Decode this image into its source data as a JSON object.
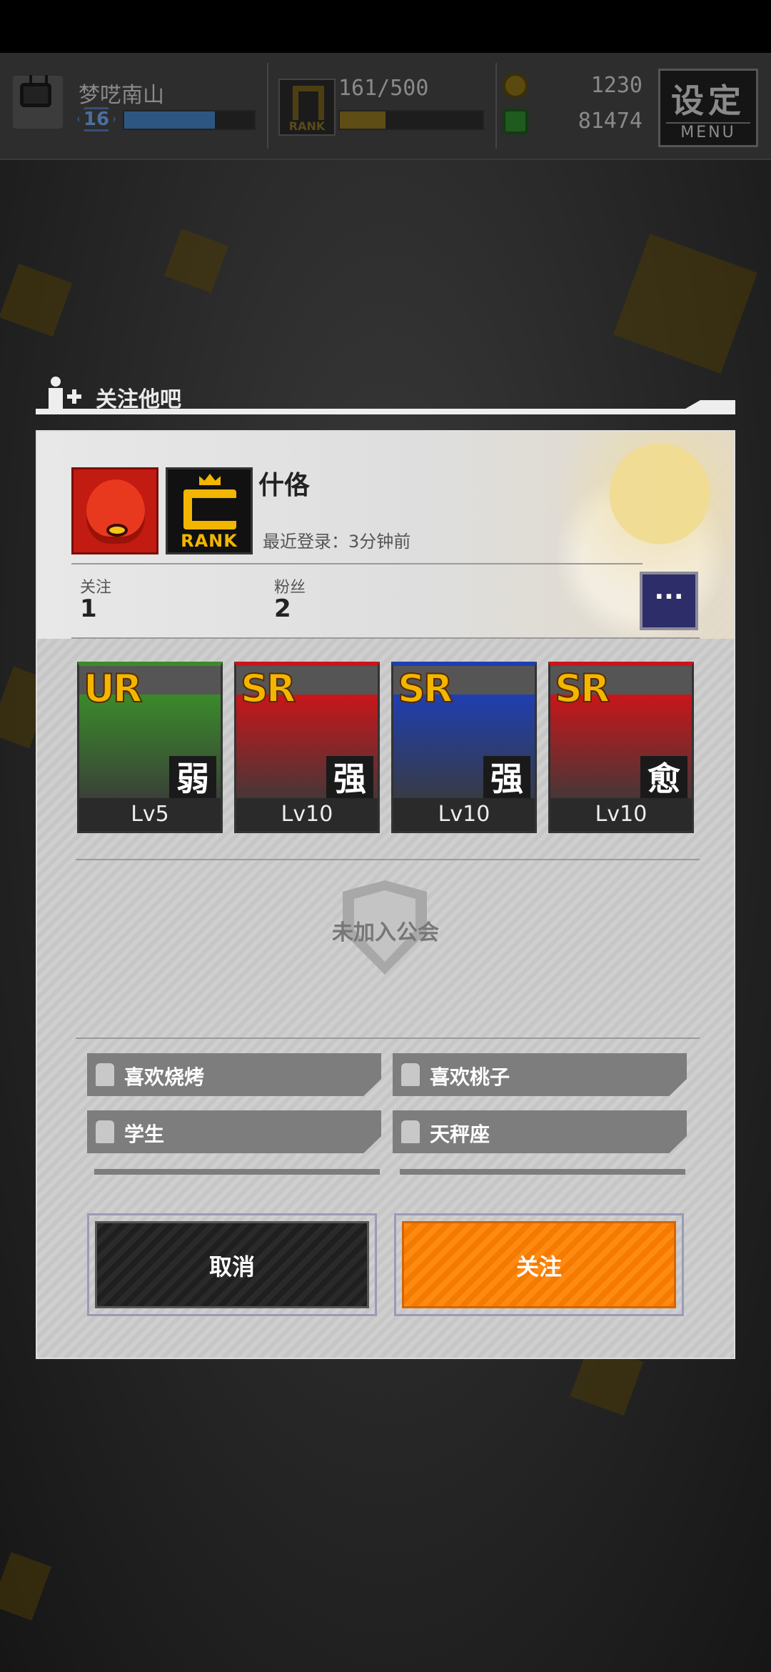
{
  "hud": {
    "player_name": "梦呓南山",
    "player_level": "16",
    "player_level_progress": 0.7,
    "rank_value": "161/500",
    "rank_progress": 0.32,
    "rank_icon_label": "RANK",
    "currency_gold": "1230",
    "currency_gem": "81474",
    "menu_big": "设定",
    "menu_small": "MENU"
  },
  "dialog": {
    "title": "关注他吧",
    "profile": {
      "name": "什佫",
      "rank_label": "RANK",
      "last_login": "最近登录：3分钟前",
      "follow_label": "关注",
      "follow_value": "1",
      "fans_label": "粉丝",
      "fans_value": "2",
      "more_label": "···"
    },
    "cards": [
      {
        "rarity": "UR",
        "attribute": "弱",
        "level": "Lv5",
        "color": "#3a8a2a"
      },
      {
        "rarity": "SR",
        "attribute": "强",
        "level": "Lv10",
        "color": "#c8161a"
      },
      {
        "rarity": "SR",
        "attribute": "强",
        "level": "Lv10",
        "color": "#1f3fb0"
      },
      {
        "rarity": "SR",
        "attribute": "愈",
        "level": "Lv10",
        "color": "#c8161a"
      }
    ],
    "guild_text": "未加入公会",
    "tags": [
      "喜欢烧烤",
      "喜欢桃子",
      "学生",
      "天秤座"
    ],
    "cancel_label": "取消",
    "follow_button_label": "关注"
  }
}
